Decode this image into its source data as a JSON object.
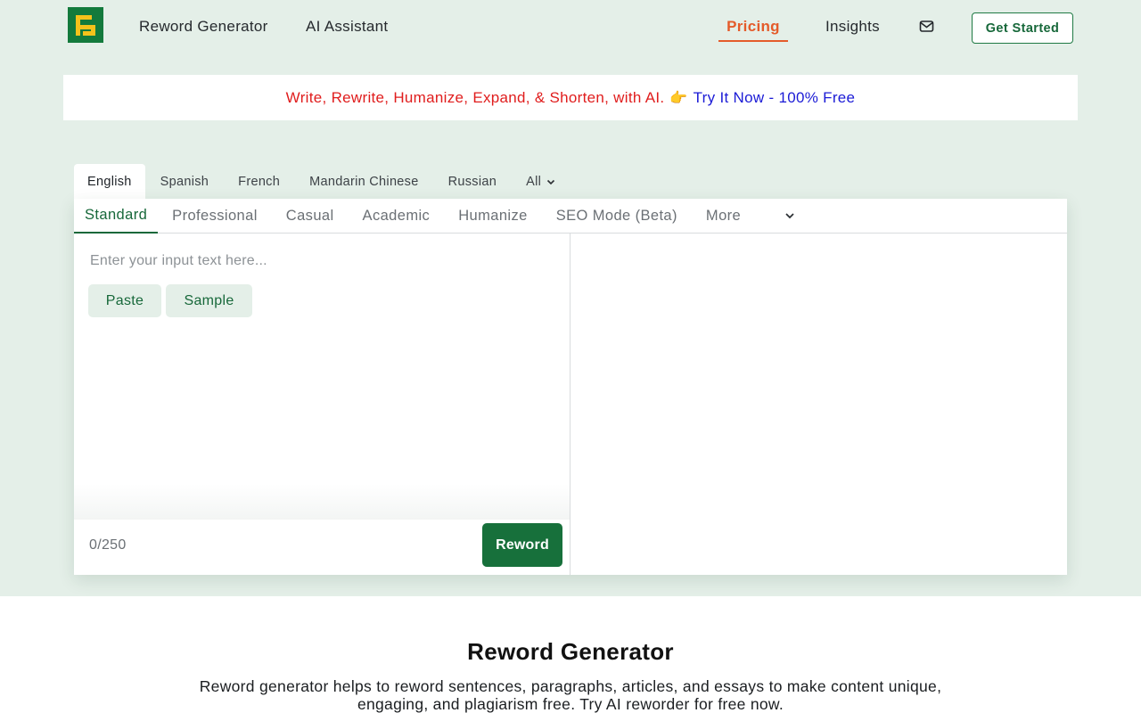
{
  "header": {
    "nav": {
      "reword_generator": "Reword Generator",
      "ai_assistant": "AI Assistant",
      "pricing": "Pricing",
      "insights": "Insights"
    },
    "get_started": "Get Started"
  },
  "promo": {
    "text_red": "Write, Rewrite, Humanize, Expand, & Shorten, with AI.",
    "emoji": "👉",
    "text_blue": "Try It Now - 100% Free"
  },
  "languages": {
    "items": [
      "English",
      "Spanish",
      "French",
      "Mandarin Chinese",
      "Russian"
    ],
    "all_label": "All",
    "selected": "English"
  },
  "modes": {
    "items": [
      "Standard",
      "Professional",
      "Casual",
      "Academic",
      "Humanize",
      "SEO Mode (Beta)"
    ],
    "more_label": "More",
    "selected": "Standard"
  },
  "editor": {
    "placeholder": "Enter your input text here...",
    "input_value": "",
    "paste_label": "Paste",
    "sample_label": "Sample",
    "counter": "0/250",
    "reword_label": "Reword"
  },
  "section": {
    "title": "Reword Generator",
    "description": "Reword generator helps to reword sentences, paragraphs, articles, and essays to make content unique, engaging, and plagiarism free. Try AI reworder for free now."
  },
  "colors": {
    "brand_green": "#17703b",
    "hero_bg": "#e4efe8",
    "pricing_accent": "#e45b2a",
    "promo_red": "#e01d1d",
    "promo_blue": "#1b1bd6"
  },
  "icons": {
    "logo": "rg-logo-icon",
    "mail": "mail-icon",
    "chevron": "chevron-down-icon"
  }
}
